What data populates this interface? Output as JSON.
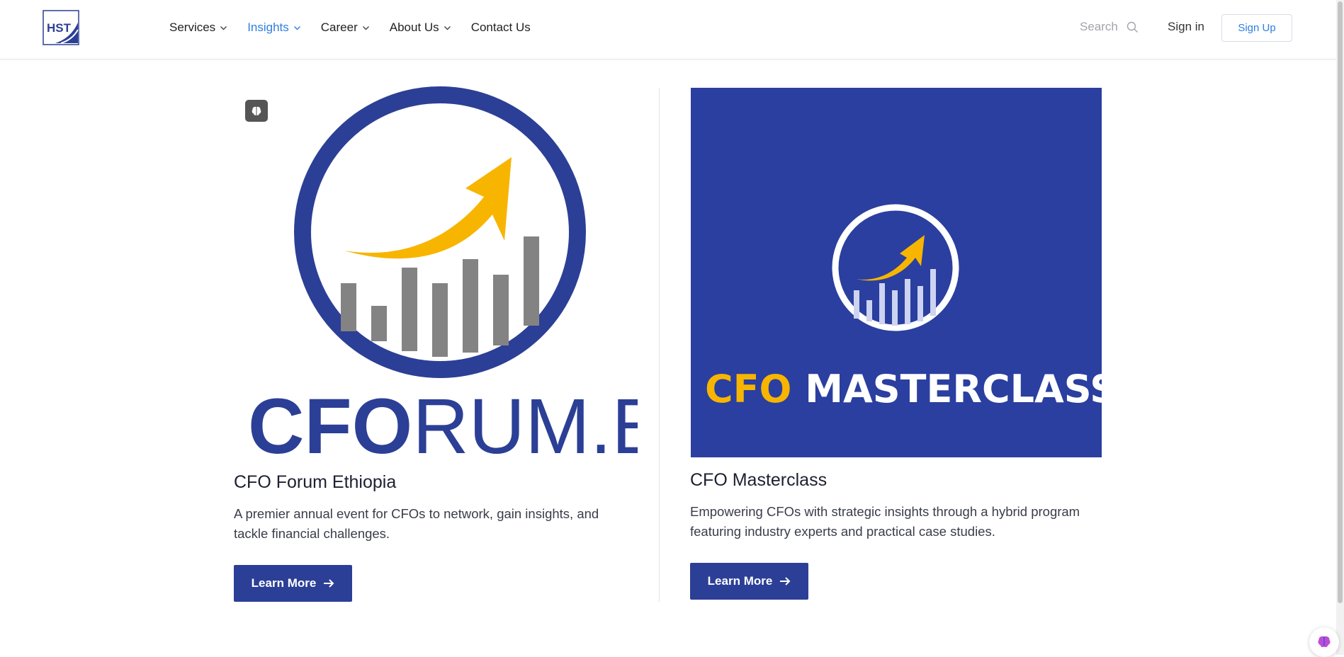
{
  "header": {
    "logo_text": "HST",
    "nav": [
      {
        "label": "Services",
        "has_dropdown": true
      },
      {
        "label": "Insights",
        "has_dropdown": true,
        "active": true
      },
      {
        "label": "Career",
        "has_dropdown": true
      },
      {
        "label": "About Us",
        "has_dropdown": true
      },
      {
        "label": "Contact Us",
        "has_dropdown": false
      }
    ],
    "search_placeholder": "Search",
    "signin_label": "Sign in",
    "signup_label": "Sign Up"
  },
  "cards": [
    {
      "image_wordmark_bold": "CFO",
      "image_wordmark_light": "RUM.ET",
      "title": "CFO Forum Ethiopia",
      "description": "A premier annual event for CFOs to network, gain insights, and tackle financial challenges.",
      "button_label": "Learn More"
    },
    {
      "image_wordmark_accent": "CFO",
      "image_wordmark_main": "MASTERCLASS",
      "title": "CFO Masterclass",
      "description": "Empowering CFOs with strategic insights through a hybrid program featuring industry experts and practical case studies.",
      "button_label": "Learn More"
    }
  ],
  "colors": {
    "brand_blue": "#2c3f96",
    "nav_active": "#2d7fe0",
    "accent_yellow": "#f7b500",
    "masterclass_bg": "#2a3f9f"
  }
}
